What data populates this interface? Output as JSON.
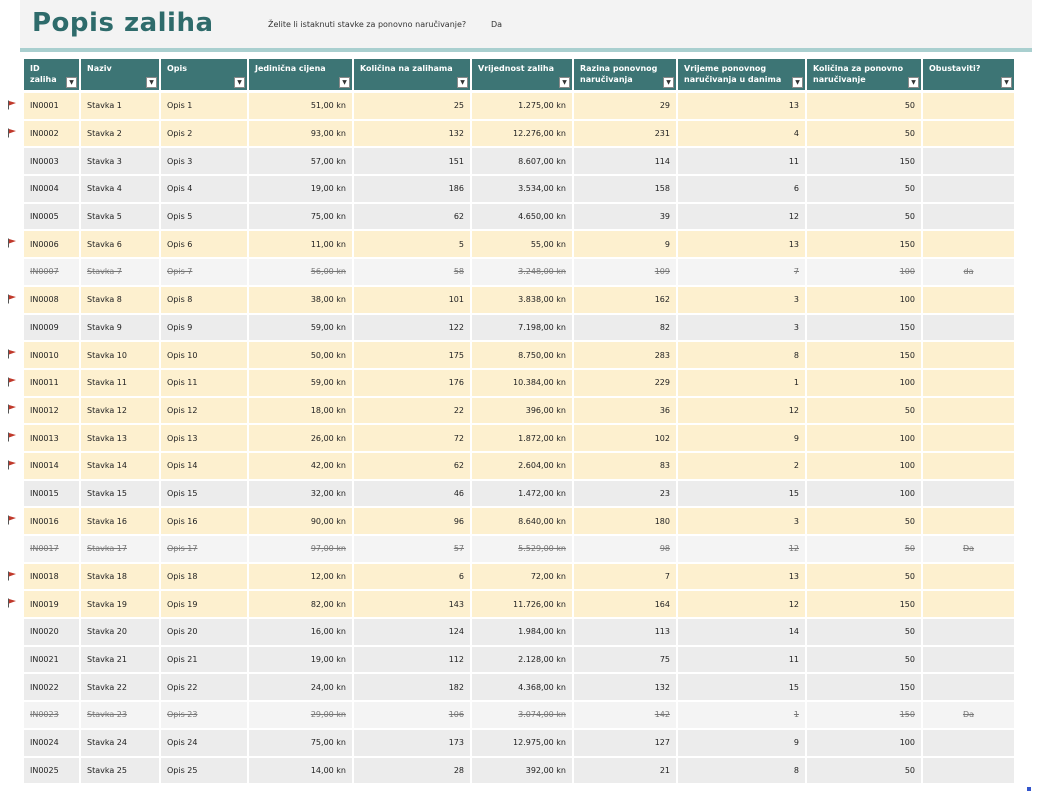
{
  "sheet": {
    "title": "Popis zaliha",
    "question": "Želite li istaknuti stavke za ponovno naručivanje?",
    "answer": "Da"
  },
  "colors": {
    "header": "#3d7575",
    "title": "#2e6b6b",
    "flag_row": "#fdf0cf",
    "plain_row": "#ececec",
    "flag": "#c0392b"
  },
  "columns": [
    "ID zaliha",
    "Naziv",
    "Opis",
    "Jedinična cijena",
    "Količina na zalihama",
    "Vrijednost zaliha",
    "Razina ponovnog naručivanja",
    "Vrijeme ponovnog naručivanja u danima",
    "Količina za ponovno naručivanje",
    "Obustaviti?"
  ],
  "rows": [
    {
      "id": "IN0001",
      "name": "Stavka 1",
      "desc": "Opis 1",
      "price": "51,00 kn",
      "qty": "25",
      "value": "1.275,00 kn",
      "level": "29",
      "days": "13",
      "reorder": "50",
      "disc": "",
      "flagged": true
    },
    {
      "id": "IN0002",
      "name": "Stavka 2",
      "desc": "Opis 2",
      "price": "93,00 kn",
      "qty": "132",
      "value": "12.276,00 kn",
      "level": "231",
      "days": "4",
      "reorder": "50",
      "disc": "",
      "flagged": true
    },
    {
      "id": "IN0003",
      "name": "Stavka 3",
      "desc": "Opis 3",
      "price": "57,00 kn",
      "qty": "151",
      "value": "8.607,00 kn",
      "level": "114",
      "days": "11",
      "reorder": "150",
      "disc": "",
      "flagged": false
    },
    {
      "id": "IN0004",
      "name": "Stavka 4",
      "desc": "Opis 4",
      "price": "19,00 kn",
      "qty": "186",
      "value": "3.534,00 kn",
      "level": "158",
      "days": "6",
      "reorder": "50",
      "disc": "",
      "flagged": false
    },
    {
      "id": "IN0005",
      "name": "Stavka 5",
      "desc": "Opis 5",
      "price": "75,00 kn",
      "qty": "62",
      "value": "4.650,00 kn",
      "level": "39",
      "days": "12",
      "reorder": "50",
      "disc": "",
      "flagged": false
    },
    {
      "id": "IN0006",
      "name": "Stavka 6",
      "desc": "Opis 6",
      "price": "11,00 kn",
      "qty": "5",
      "value": "55,00 kn",
      "level": "9",
      "days": "13",
      "reorder": "150",
      "disc": "",
      "flagged": true
    },
    {
      "id": "IN0007",
      "name": "Stavka 7",
      "desc": "Opis 7",
      "price": "56,00 kn",
      "qty": "58",
      "value": "3.248,00 kn",
      "level": "109",
      "days": "7",
      "reorder": "100",
      "disc": "da",
      "flagged": false,
      "discontinued": true
    },
    {
      "id": "IN0008",
      "name": "Stavka 8",
      "desc": "Opis 8",
      "price": "38,00 kn",
      "qty": "101",
      "value": "3.838,00 kn",
      "level": "162",
      "days": "3",
      "reorder": "100",
      "disc": "",
      "flagged": true
    },
    {
      "id": "IN0009",
      "name": "Stavka 9",
      "desc": "Opis 9",
      "price": "59,00 kn",
      "qty": "122",
      "value": "7.198,00 kn",
      "level": "82",
      "days": "3",
      "reorder": "150",
      "disc": "",
      "flagged": false
    },
    {
      "id": "IN0010",
      "name": "Stavka 10",
      "desc": "Opis 10",
      "price": "50,00 kn",
      "qty": "175",
      "value": "8.750,00 kn",
      "level": "283",
      "days": "8",
      "reorder": "150",
      "disc": "",
      "flagged": true
    },
    {
      "id": "IN0011",
      "name": "Stavka 11",
      "desc": "Opis 11",
      "price": "59,00 kn",
      "qty": "176",
      "value": "10.384,00 kn",
      "level": "229",
      "days": "1",
      "reorder": "100",
      "disc": "",
      "flagged": true
    },
    {
      "id": "IN0012",
      "name": "Stavka 12",
      "desc": "Opis 12",
      "price": "18,00 kn",
      "qty": "22",
      "value": "396,00 kn",
      "level": "36",
      "days": "12",
      "reorder": "50",
      "disc": "",
      "flagged": true
    },
    {
      "id": "IN0013",
      "name": "Stavka 13",
      "desc": "Opis 13",
      "price": "26,00 kn",
      "qty": "72",
      "value": "1.872,00 kn",
      "level": "102",
      "days": "9",
      "reorder": "100",
      "disc": "",
      "flagged": true
    },
    {
      "id": "IN0014",
      "name": "Stavka 14",
      "desc": "Opis 14",
      "price": "42,00 kn",
      "qty": "62",
      "value": "2.604,00 kn",
      "level": "83",
      "days": "2",
      "reorder": "100",
      "disc": "",
      "flagged": true
    },
    {
      "id": "IN0015",
      "name": "Stavka 15",
      "desc": "Opis 15",
      "price": "32,00 kn",
      "qty": "46",
      "value": "1.472,00 kn",
      "level": "23",
      "days": "15",
      "reorder": "100",
      "disc": "",
      "flagged": false
    },
    {
      "id": "IN0016",
      "name": "Stavka 16",
      "desc": "Opis 16",
      "price": "90,00 kn",
      "qty": "96",
      "value": "8.640,00 kn",
      "level": "180",
      "days": "3",
      "reorder": "50",
      "disc": "",
      "flagged": true
    },
    {
      "id": "IN0017",
      "name": "Stavka 17",
      "desc": "Opis 17",
      "price": "97,00 kn",
      "qty": "57",
      "value": "5.529,00 kn",
      "level": "98",
      "days": "12",
      "reorder": "50",
      "disc": "Da",
      "flagged": false,
      "discontinued": true
    },
    {
      "id": "IN0018",
      "name": "Stavka 18",
      "desc": "Opis 18",
      "price": "12,00 kn",
      "qty": "6",
      "value": "72,00 kn",
      "level": "7",
      "days": "13",
      "reorder": "50",
      "disc": "",
      "flagged": true
    },
    {
      "id": "IN0019",
      "name": "Stavka 19",
      "desc": "Opis 19",
      "price": "82,00 kn",
      "qty": "143",
      "value": "11.726,00 kn",
      "level": "164",
      "days": "12",
      "reorder": "150",
      "disc": "",
      "flagged": true
    },
    {
      "id": "IN0020",
      "name": "Stavka 20",
      "desc": "Opis 20",
      "price": "16,00 kn",
      "qty": "124",
      "value": "1.984,00 kn",
      "level": "113",
      "days": "14",
      "reorder": "50",
      "disc": "",
      "flagged": false
    },
    {
      "id": "IN0021",
      "name": "Stavka 21",
      "desc": "Opis 21",
      "price": "19,00 kn",
      "qty": "112",
      "value": "2.128,00 kn",
      "level": "75",
      "days": "11",
      "reorder": "50",
      "disc": "",
      "flagged": false
    },
    {
      "id": "IN0022",
      "name": "Stavka 22",
      "desc": "Opis 22",
      "price": "24,00 kn",
      "qty": "182",
      "value": "4.368,00 kn",
      "level": "132",
      "days": "15",
      "reorder": "150",
      "disc": "",
      "flagged": false
    },
    {
      "id": "IN0023",
      "name": "Stavka 23",
      "desc": "Opis 23",
      "price": "29,00 kn",
      "qty": "106",
      "value": "3.074,00 kn",
      "level": "142",
      "days": "1",
      "reorder": "150",
      "disc": "Da",
      "flagged": false,
      "discontinued": true
    },
    {
      "id": "IN0024",
      "name": "Stavka 24",
      "desc": "Opis 24",
      "price": "75,00 kn",
      "qty": "173",
      "value": "12.975,00 kn",
      "level": "127",
      "days": "9",
      "reorder": "100",
      "disc": "",
      "flagged": false
    },
    {
      "id": "IN0025",
      "name": "Stavka 25",
      "desc": "Opis 25",
      "price": "14,00 kn",
      "qty": "28",
      "value": "392,00 kn",
      "level": "21",
      "days": "8",
      "reorder": "50",
      "disc": "",
      "flagged": false
    }
  ]
}
